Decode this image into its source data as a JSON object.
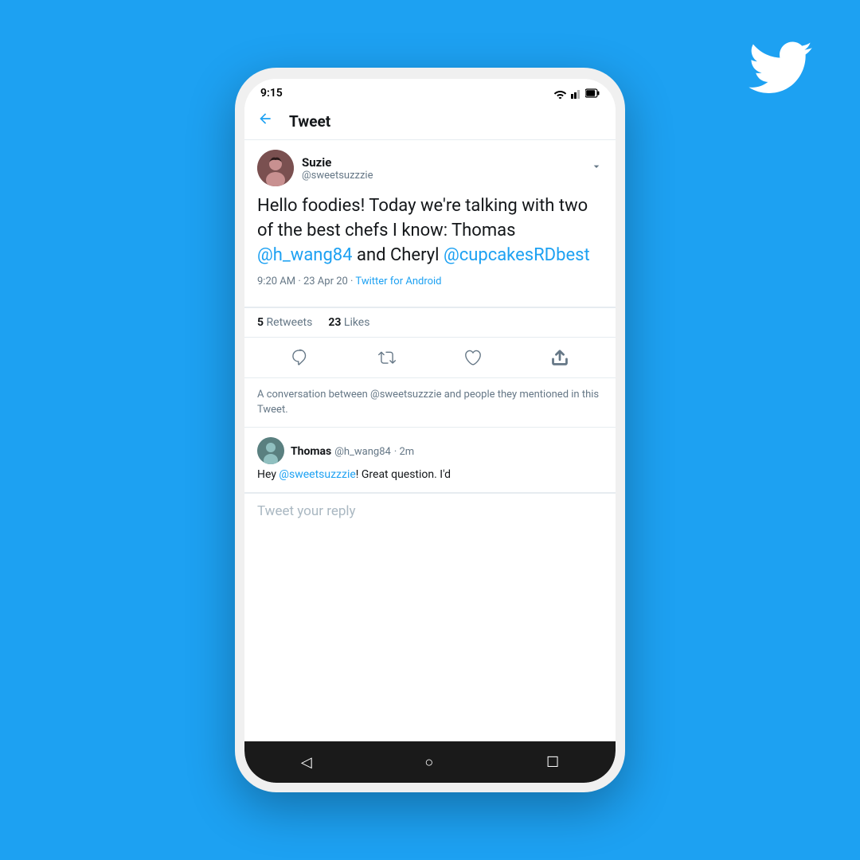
{
  "background_color": "#1DA1F2",
  "header": {
    "title": "Tweet",
    "back_label": "←"
  },
  "status_bar": {
    "time": "9:15"
  },
  "original_tweet": {
    "author": {
      "name": "Suzie",
      "handle": "@sweetsuzzzie"
    },
    "text_parts": [
      {
        "type": "text",
        "content": "Hello foodies! Today we're talking with two of the best chefs I know: Thomas "
      },
      {
        "type": "mention",
        "content": "@h_wang84"
      },
      {
        "type": "text",
        "content": " and Cheryl "
      },
      {
        "type": "mention",
        "content": "@cupcakesRDbest"
      }
    ],
    "timestamp": "9:20 AM · 23 Apr 20 · ",
    "source": "Twitter for Android",
    "retweets": 5,
    "retweets_label": "Retweets",
    "likes": 23,
    "likes_label": "Likes"
  },
  "conversation_note": {
    "text": "A conversation between @sweetsuzzzie and people they mentioned in this Tweet."
  },
  "reply_tweet": {
    "author": {
      "name": "Thomas",
      "handle": "@h_wang84",
      "time_ago": "2m"
    },
    "text_parts": [
      {
        "type": "text",
        "content": "Hey "
      },
      {
        "type": "mention",
        "content": "@sweetsuzzzie"
      },
      {
        "type": "text",
        "content": "! Great question. I'd"
      }
    ]
  },
  "reply_input": {
    "placeholder": "Tweet your reply"
  },
  "actions": {
    "reply": "reply",
    "retweet": "retweet",
    "like": "like",
    "mail": "mail"
  },
  "android_nav": {
    "back": "◁",
    "home": "○",
    "recents": "☐"
  }
}
